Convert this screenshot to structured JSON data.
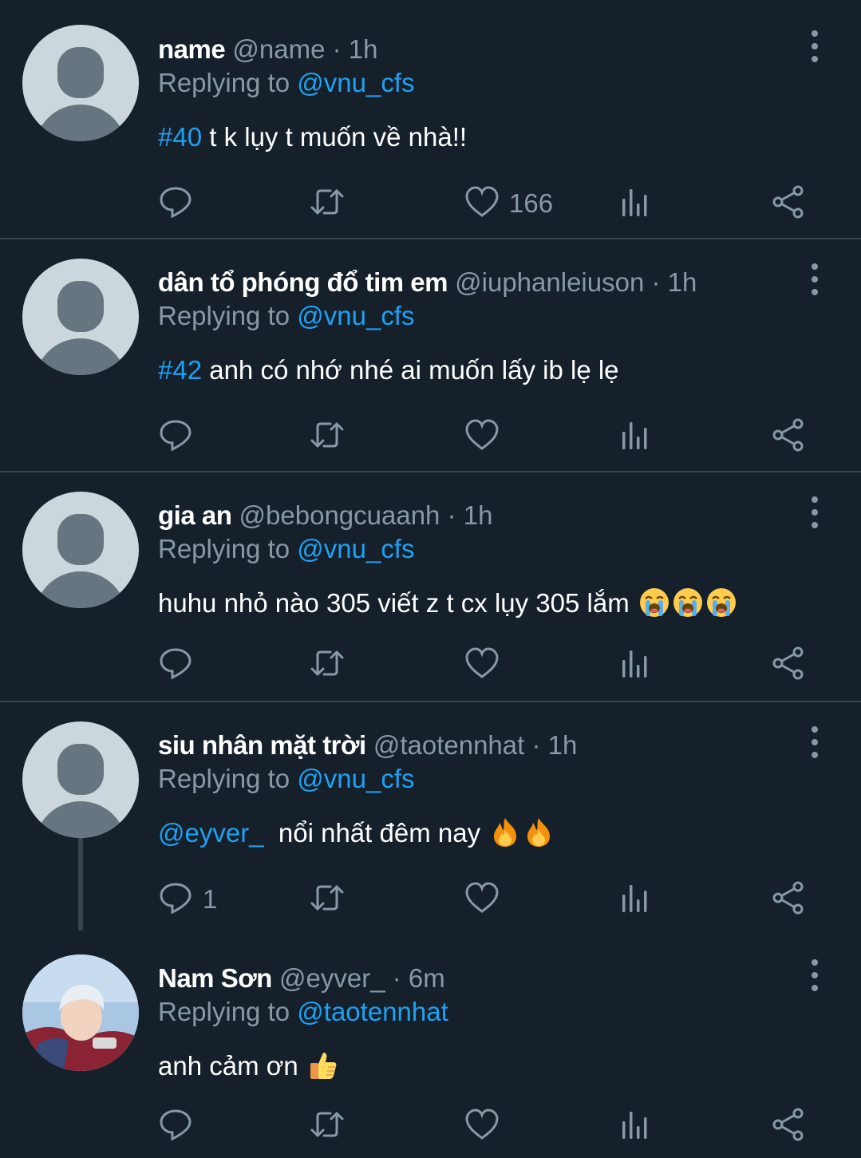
{
  "tweets": [
    {
      "name": "name",
      "handle": "@name",
      "dot": "·",
      "time": "1h",
      "replying_prefix": "Replying to",
      "replying_to": "@vnu_cfs",
      "tag": "#40",
      "text": " t k lụy t muốn về nhà!!",
      "reply_count": "",
      "like_count": "166"
    },
    {
      "name": "dân tổ phóng đổ tim em",
      "handle": "@iuphanleiuson",
      "dot": "·",
      "time": "1h",
      "replying_prefix": "Replying to",
      "replying_to": "@vnu_cfs",
      "tag": "#42",
      "text": " anh có nhớ nhé ai muốn lấy ib lẹ lẹ",
      "reply_count": "",
      "like_count": ""
    },
    {
      "name": "gia an",
      "handle": "@bebongcuaanh",
      "dot": "·",
      "time": "1h",
      "replying_prefix": "Replying to",
      "replying_to": "@vnu_cfs",
      "tag": "",
      "text": "huhu nhỏ nào 305 viết z t cx lụy 305 lắm ",
      "emojis": [
        "loudly-crying-face",
        "loudly-crying-face",
        "loudly-crying-face"
      ],
      "reply_count": "",
      "like_count": ""
    },
    {
      "name": "siu nhân mặt trời",
      "handle": "@taotennhat",
      "dot": "·",
      "time": "1h",
      "replying_prefix": "Replying to",
      "replying_to": "@vnu_cfs",
      "tag": "@eyver_",
      "text": "  nổi nhất đêm nay ",
      "emojis": [
        "fire",
        "fire"
      ],
      "reply_count": "1",
      "like_count": ""
    },
    {
      "name": "Nam Sơn",
      "handle": "@eyver_",
      "dot": "·",
      "time": "6m",
      "replying_prefix": "Replying to",
      "replying_to": "@taotennhat",
      "tag": "",
      "text": "anh cảm ơn ",
      "emojis": [
        "thumbs-up"
      ],
      "reply_count": "",
      "like_count": ""
    }
  ],
  "colors": {
    "background": "#15202b",
    "divider": "#38444d",
    "secondary_text": "#8899a6",
    "link": "#1da1f2",
    "avatar_placeholder": "#ccd6dd",
    "avatar_silhouette": "#66757f"
  },
  "icons": [
    "reply-icon",
    "retweet-icon",
    "like-icon",
    "analytics-icon",
    "share-icon",
    "more-options-icon"
  ]
}
